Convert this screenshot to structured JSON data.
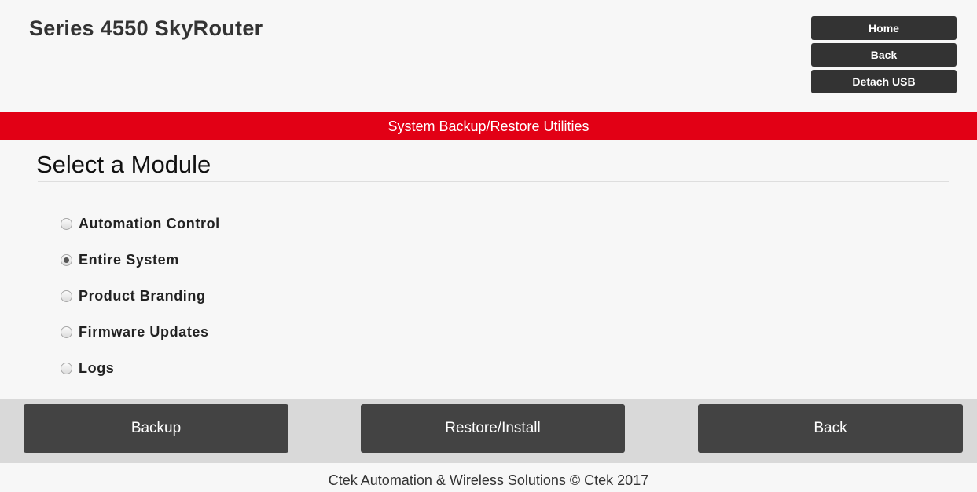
{
  "header": {
    "title": "Series 4550 SkyRouter",
    "nav": [
      {
        "label": "Home"
      },
      {
        "label": "Back"
      },
      {
        "label": "Detach USB"
      }
    ]
  },
  "banner": {
    "text": "System Backup/Restore Utilities"
  },
  "main": {
    "section_title": "Select a Module",
    "options": [
      {
        "label": "Automation Control",
        "checked": false
      },
      {
        "label": "Entire System",
        "checked": true
      },
      {
        "label": "Product Branding",
        "checked": false
      },
      {
        "label": "Firmware Updates",
        "checked": false
      },
      {
        "label": "Logs",
        "checked": false
      }
    ]
  },
  "actions": {
    "backup_label": "Backup",
    "restore_label": "Restore/Install",
    "back_label": "Back"
  },
  "footer": {
    "text": "Ctek Automation & Wireless Solutions © Ctek 2017"
  },
  "colors": {
    "banner": "#e20015",
    "button": "#434343",
    "top_button": "#333333"
  }
}
